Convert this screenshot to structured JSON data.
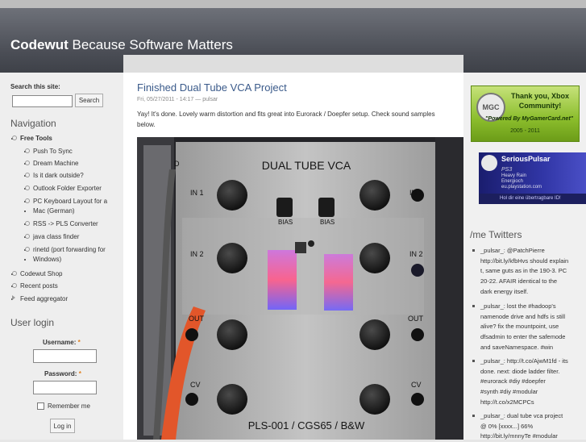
{
  "site": {
    "name": "Codewut",
    "slogan": "Because Software Matters"
  },
  "search": {
    "label": "Search this site:",
    "button": "Search",
    "value": ""
  },
  "navigation": {
    "title": "Navigation",
    "items": [
      {
        "label": "Free Tools"
      },
      {
        "label": "Push To Sync"
      },
      {
        "label": "Dream Machine"
      },
      {
        "label": "Is it dark outside?"
      },
      {
        "label": "Outlook Folder Exporter"
      },
      {
        "label": "PC Keyboard Layout for a"
      },
      {
        "label": "Mac (German)"
      },
      {
        "label": "RSS -> PLS Converter"
      },
      {
        "label": "java class finder"
      },
      {
        "label": "rinetd (port forwarding for"
      },
      {
        "label": "Windows)"
      },
      {
        "label": "Codewut Shop"
      },
      {
        "label": "Recent posts"
      },
      {
        "label": "Feed aggregator"
      }
    ]
  },
  "login": {
    "title": "User login",
    "username_label": "Username:",
    "password_label": "Password:",
    "required_mark": "*",
    "remember_label": "Remember me",
    "button": "Log in"
  },
  "post": {
    "title": "Finished Dual Tube VCA Project",
    "meta": "Fri, 05/27/2011 - 14:17 — pulsar",
    "body": "Yay! It's done. Lovely warm distortion and fits great into Eurorack / Doepfer setup. Check sound samples below.",
    "photo": {
      "title": "DUAL TUBE VCA",
      "left_labels": [
        "D",
        "IN 1",
        "IN 2",
        "OUT",
        "CV"
      ],
      "right_labels": [
        "IN 1",
        "IN 2",
        "OUT",
        "CV"
      ],
      "bias_label": "BIAS",
      "footer": "PLS-001 / CGS65 / B&W"
    }
  },
  "gamercard": {
    "badge": "MGC",
    "text": "Thank you, Xbox Community!",
    "subtext": "\"Powered By MyGamerCard.net\"",
    "years": "2005 - 2011",
    "color": "#8bbd2c"
  },
  "psn": {
    "name": "SeriousPulsar",
    "logo": "PS3",
    "games": [
      "Heavy Rain",
      "Energioch",
      "eu.playstation.com"
    ],
    "footer": "Hol dir eine übertragbare ID!"
  },
  "twitter": {
    "title": "/me Twitters",
    "tweets": [
      {
        "lines": [
          "_pulsar_: @PatchPierre",
          "http://bit.ly/kfbHvs should explain",
          "t, same guts as in the 190-3. PC",
          "20-22. AFAIR identical to the",
          "dark energy itself."
        ]
      },
      {
        "lines": [
          "_pulsar_: lost the #hadoop's",
          "namenode drive and hdfs is still",
          "alive? fix the mountpoint, use",
          "dfsadmin to enter the safemode",
          "and saveNamespace. #win"
        ]
      },
      {
        "lines": [
          "_pulsar_: http://t.co/AjwM1fd - its",
          "done. next: diode ladder filter.",
          "#eurorack #diy #doepfer",
          "#synth #diy #modular",
          "http://t.co/x2MCPCs"
        ]
      },
      {
        "lines": [
          "_pulsar_: dual tube vca project",
          "@ 0% [xxxx...] 66%",
          "http://bit.ly/mnnyTe #modular"
        ]
      }
    ]
  }
}
